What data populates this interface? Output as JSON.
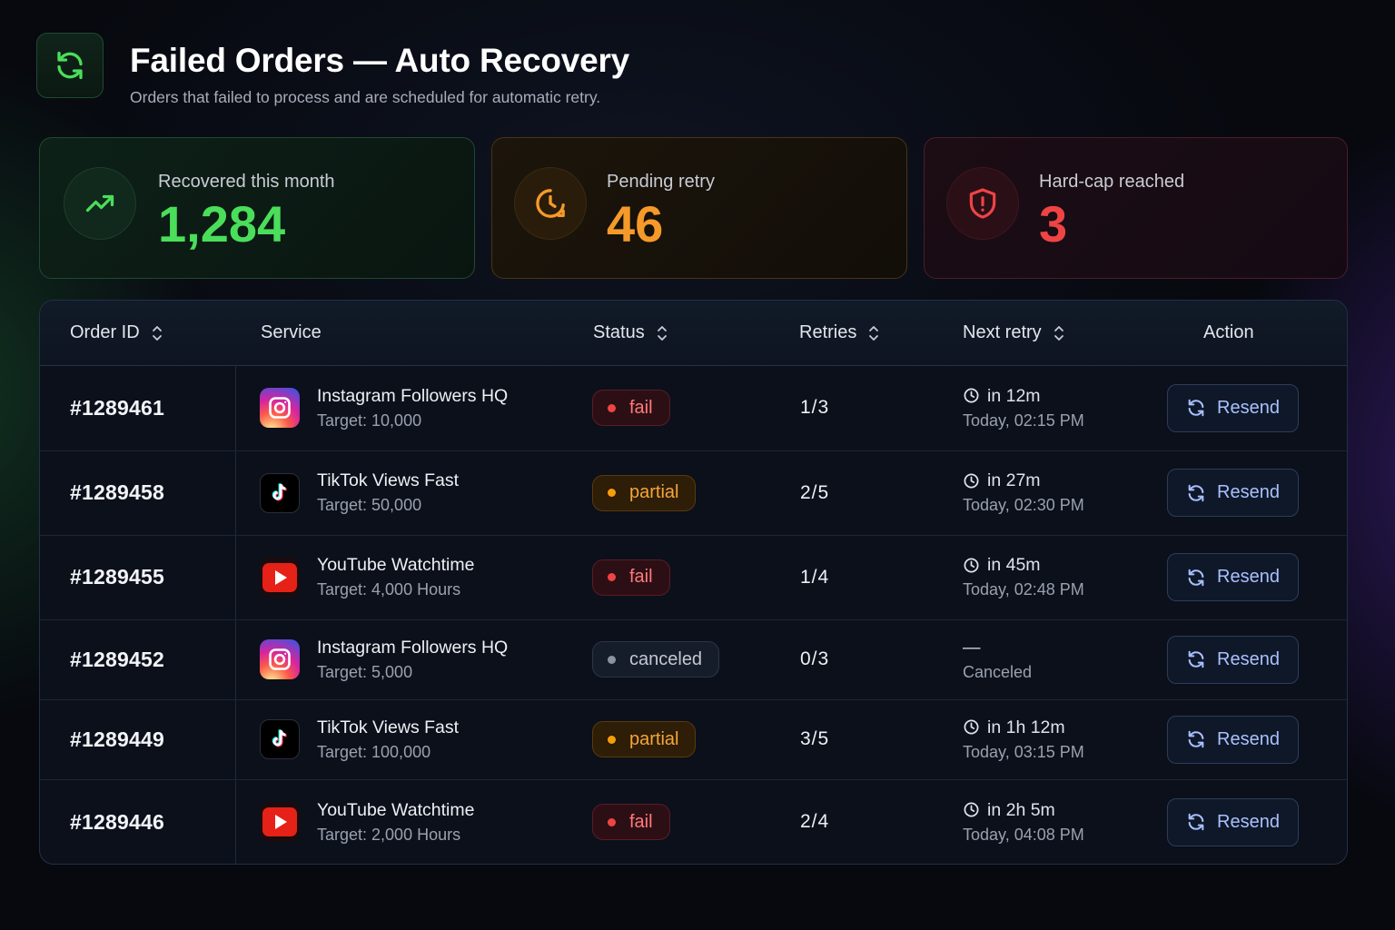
{
  "header": {
    "title": "Failed Orders — Auto Recovery",
    "subtitle": "Orders that failed to process and are scheduled for automatic retry."
  },
  "stats": [
    {
      "label": "Recovered this month",
      "value": "1,284",
      "icon": "trending-up-icon",
      "color": "#4ade5a"
    },
    {
      "label": "Pending retry",
      "value": "46",
      "icon": "clock-icon",
      "color": "#f59a2a"
    },
    {
      "label": "Hard-cap reached",
      "value": "3",
      "icon": "shield-alert-icon",
      "color": "#ef4444"
    }
  ],
  "table": {
    "columns": [
      "Order ID",
      "Service",
      "Status",
      "Retries",
      "Next retry",
      "Action"
    ],
    "rows": [
      {
        "id": "#1289461",
        "service": "Instagram Followers HQ",
        "target": "Target: 10,000",
        "platform": "instagram",
        "status": "fail",
        "retries": "1/3",
        "next": "in 12m",
        "next_time": "Today, 02:15 PM",
        "action": "Resend"
      },
      {
        "id": "#1289458",
        "service": "TikTok Views Fast",
        "target": "Target: 50,000",
        "platform": "tiktok",
        "status": "partial",
        "retries": "2/5",
        "next": "in 27m",
        "next_time": "Today, 02:30 PM",
        "action": "Resend"
      },
      {
        "id": "#1289455",
        "service": "YouTube Watchtime",
        "target": "Target: 4,000 Hours",
        "platform": "youtube",
        "status": "fail",
        "retries": "1/4",
        "next": "in 45m",
        "next_time": "Today, 02:48 PM",
        "action": "Resend"
      },
      {
        "id": "#1289452",
        "service": "Instagram Followers HQ",
        "target": "Target: 5,000",
        "platform": "instagram",
        "status": "canceled",
        "retries": "0/3",
        "next": "—",
        "next_time": "Canceled",
        "action": "Resend"
      },
      {
        "id": "#1289449",
        "service": "TikTok Views Fast",
        "target": "Target: 100,000",
        "platform": "tiktok",
        "status": "partial",
        "retries": "3/5",
        "next": "in 1h 12m",
        "next_time": "Today, 03:15 PM",
        "action": "Resend"
      },
      {
        "id": "#1289446",
        "service": "YouTube Watchtime",
        "target": "Target: 2,000 Hours",
        "platform": "youtube",
        "status": "fail",
        "retries": "2/4",
        "next": "in 2h 5m",
        "next_time": "Today, 04:08 PM",
        "action": "Resend"
      }
    ]
  },
  "colors": {
    "accent_green": "#4ade5a",
    "accent_orange": "#f59a2a",
    "accent_red": "#ef4444",
    "button_text": "#a9c0ff"
  }
}
